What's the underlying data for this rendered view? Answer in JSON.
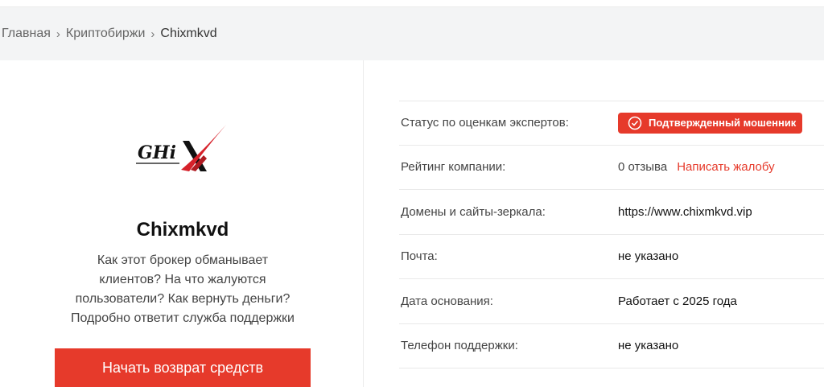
{
  "breadcrumb": {
    "home": "Главная",
    "section": "Криптобиржи",
    "current": "Chixmkvd"
  },
  "company": {
    "name": "Chixmkvd",
    "logo_text": "GHiX",
    "lead_lines": [
      "Как этот брокер обманывает",
      "клиентов? На что жалуются",
      "пользователи? Как вернуть деньги?",
      "Подробно ответит служба поддержки"
    ],
    "cta_label": "Начать возврат средств"
  },
  "info": {
    "status_label": "Статус по оценкам экспертов:",
    "status_value": "Подтвержденный мошенник",
    "rating_label": "Рейтинг компании:",
    "rating_value": "0 отзыва",
    "complaint_link": "Написать жалобу",
    "domains_label": "Домены и сайты-зеркала:",
    "domains_value": "https://www.chixmkvd.vip",
    "email_label": "Почта:",
    "email_value": "не указано",
    "founded_label": "Дата основания:",
    "founded_value": "Работает с 2025 года",
    "phone_label": "Телефон поддержки:",
    "phone_value": "не указано"
  },
  "colors": {
    "accent": "#e63a2b",
    "breadcrumb_bg": "#f3f4f5"
  },
  "icons": {
    "crumb_separator": "chevron-right-icon",
    "status": "check-circle-icon"
  }
}
